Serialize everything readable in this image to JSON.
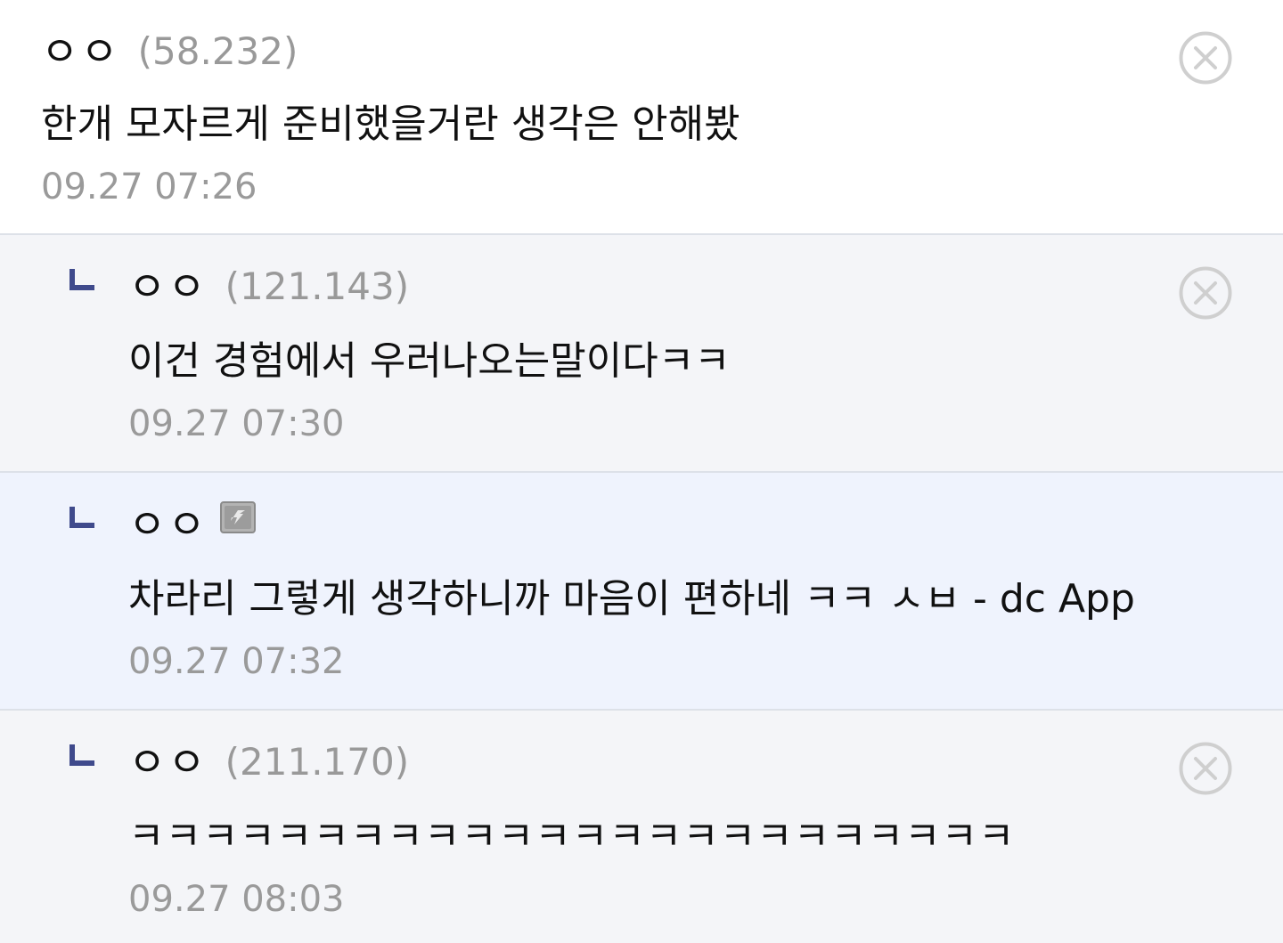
{
  "comments": [
    {
      "nickname": "ㅇㅇ",
      "ip": "(58.232)",
      "text": "한개 모자르게 준비했을거란 생각은 안해봤",
      "date": "09.27 07:26",
      "is_reply": false,
      "delete_icon": "close-circle-icon"
    },
    {
      "nickname": "ㅇㅇ",
      "ip": "(121.143)",
      "text": "이건 경험에서 우러나오는말이다ㅋㅋ",
      "date": "09.27 07:30",
      "is_reply": true,
      "delete_icon": "close-circle-icon"
    },
    {
      "nickname": "ㅇㅇ",
      "badge_icon": "fixed-nick-icon",
      "text": "차라리 그렇게 생각하니까 마음이 편하네 ㅋㅋ ㅅㅂ - dc App",
      "date": "09.27 07:32",
      "is_reply": true
    },
    {
      "nickname": "ㅇㅇ",
      "ip": "(211.170)",
      "text": "ㅋㅋㅋㅋㅋㅋㅋㅋㅋㅋㅋㅋㅋㅋㅋㅋㅋㅋㅋㅋㅋㅋㅋㅋ",
      "date": "09.27 08:03",
      "is_reply": true,
      "delete_icon": "close-circle-icon"
    }
  ],
  "colors": {
    "reply_arrow": "#3f4a8c",
    "ip_text": "#999999",
    "date_text": "#9a9a9a",
    "delete_icon": "#cfcfcf",
    "highlight_background": "#eff3fd",
    "reply_background": "#f4f5f8",
    "divider": "#dde1e8"
  }
}
